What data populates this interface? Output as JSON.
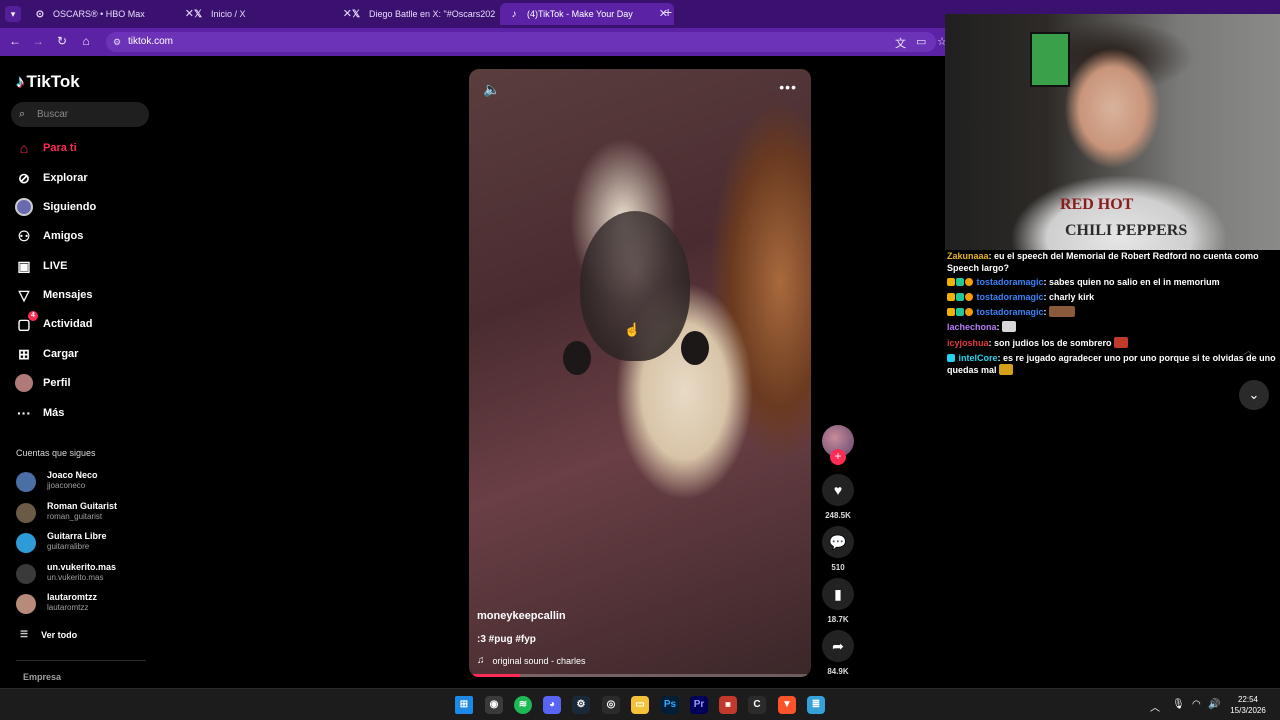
{
  "browser": {
    "tabs": [
      {
        "title": "OSCARS® • HBO Max",
        "icon": "hbo-icon"
      },
      {
        "title": "Inicio / X",
        "icon": "x-icon"
      },
      {
        "title": "Diego Batlle en X: \"#Oscars202",
        "icon": "x-icon"
      },
      {
        "title": "(4)TikTok - Make Your Day",
        "icon": "tiktok-icon"
      }
    ],
    "url": "tiktok.com"
  },
  "sidebar": {
    "logo": "TikTok",
    "search_placeholder": "Buscar",
    "nav": [
      {
        "label": "Para ti",
        "icon": "home-icon"
      },
      {
        "label": "Explorar",
        "icon": "compass-icon"
      },
      {
        "label": "Siguiendo",
        "icon": "following-avatar-icon"
      },
      {
        "label": "Amigos",
        "icon": "friends-icon"
      },
      {
        "label": "LIVE",
        "icon": "live-icon"
      },
      {
        "label": "Mensajes",
        "icon": "messages-icon"
      },
      {
        "label": "Actividad",
        "icon": "activity-icon",
        "badge": "4"
      },
      {
        "label": "Cargar",
        "icon": "upload-icon"
      },
      {
        "label": "Perfil",
        "icon": "profile-icon"
      },
      {
        "label": "Más",
        "icon": "more-icon"
      }
    ],
    "following_heading": "Cuentas que sigues",
    "accounts": [
      {
        "name": "Joaco Neco",
        "handle": "jjoaconeco",
        "color": "#4a6fa5"
      },
      {
        "name": "Roman Guitarist",
        "handle": "roman_guitarist",
        "color": "#6b5a45"
      },
      {
        "name": "Guitarra Libre",
        "handle": "guitarralibre",
        "color": "#2d9bd6"
      },
      {
        "name": "un.vukerito.mas",
        "handle": "un.vukerito.mas",
        "color": "#3a3a3a"
      },
      {
        "name": "lautaromtzz",
        "handle": "lautaromtzz",
        "color": "#b88a7a"
      }
    ],
    "see_all": "Ver todo",
    "footer": "Empresa"
  },
  "video": {
    "username": "moneykeepcallin",
    "description": ":3 #pug #fyp",
    "sound": "original sound - charles",
    "progress": 0.14
  },
  "actions": {
    "likes": "248.5K",
    "comments": "510",
    "saves": "18.7K",
    "shares": "84.9K"
  },
  "webcam": {
    "shirt_line1": "RED HOT",
    "shirt_line2": "CHILI PEPPERS"
  },
  "chat": [
    {
      "user": "Zakunaaa",
      "color": "#e6b422",
      "text": ": eu el speech del Memorial de Robert Redford no cuenta como Speech largo?"
    },
    {
      "user": "tostadoramagic",
      "color": "#3b82f6",
      "text": ": sabes quien no salio en el in memorium",
      "badges": true
    },
    {
      "user": "tostadoramagic",
      "color": "#3b82f6",
      "text": ": charly kirk",
      "badges": true
    },
    {
      "user": "tostadoramagic",
      "color": "#3b82f6",
      "text": ":",
      "badges": true,
      "emote": "#8b5a3c"
    },
    {
      "user": "lachechona",
      "color": "#b57cf5",
      "text": ":",
      "emote": "#d8d8d8"
    },
    {
      "user": "icyjoshua",
      "color": "#e03a3a",
      "text": ": son judios los de sombrero",
      "emote": "#c0392b"
    },
    {
      "user": "intelCore",
      "color": "#22d3ee",
      "text": ": es re jugado agradecer uno por uno porque si te olvidas de uno quedas mal",
      "emote": "#d4a017"
    }
  ],
  "taskbar": {
    "time": "22:54",
    "date": "15/3/2026"
  }
}
